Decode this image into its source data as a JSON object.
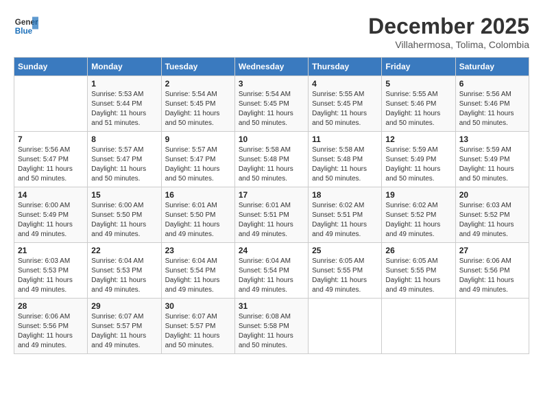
{
  "header": {
    "logo_line1": "General",
    "logo_line2": "Blue",
    "month": "December 2025",
    "location": "Villahermosa, Tolima, Colombia"
  },
  "weekdays": [
    "Sunday",
    "Monday",
    "Tuesday",
    "Wednesday",
    "Thursday",
    "Friday",
    "Saturday"
  ],
  "weeks": [
    [
      {
        "day": "",
        "sunrise": "",
        "sunset": "",
        "daylight": ""
      },
      {
        "day": "1",
        "sunrise": "Sunrise: 5:53 AM",
        "sunset": "Sunset: 5:44 PM",
        "daylight": "Daylight: 11 hours and 51 minutes."
      },
      {
        "day": "2",
        "sunrise": "Sunrise: 5:54 AM",
        "sunset": "Sunset: 5:45 PM",
        "daylight": "Daylight: 11 hours and 50 minutes."
      },
      {
        "day": "3",
        "sunrise": "Sunrise: 5:54 AM",
        "sunset": "Sunset: 5:45 PM",
        "daylight": "Daylight: 11 hours and 50 minutes."
      },
      {
        "day": "4",
        "sunrise": "Sunrise: 5:55 AM",
        "sunset": "Sunset: 5:45 PM",
        "daylight": "Daylight: 11 hours and 50 minutes."
      },
      {
        "day": "5",
        "sunrise": "Sunrise: 5:55 AM",
        "sunset": "Sunset: 5:46 PM",
        "daylight": "Daylight: 11 hours and 50 minutes."
      },
      {
        "day": "6",
        "sunrise": "Sunrise: 5:56 AM",
        "sunset": "Sunset: 5:46 PM",
        "daylight": "Daylight: 11 hours and 50 minutes."
      }
    ],
    [
      {
        "day": "7",
        "sunrise": "Sunrise: 5:56 AM",
        "sunset": "Sunset: 5:47 PM",
        "daylight": "Daylight: 11 hours and 50 minutes."
      },
      {
        "day": "8",
        "sunrise": "Sunrise: 5:57 AM",
        "sunset": "Sunset: 5:47 PM",
        "daylight": "Daylight: 11 hours and 50 minutes."
      },
      {
        "day": "9",
        "sunrise": "Sunrise: 5:57 AM",
        "sunset": "Sunset: 5:47 PM",
        "daylight": "Daylight: 11 hours and 50 minutes."
      },
      {
        "day": "10",
        "sunrise": "Sunrise: 5:58 AM",
        "sunset": "Sunset: 5:48 PM",
        "daylight": "Daylight: 11 hours and 50 minutes."
      },
      {
        "day": "11",
        "sunrise": "Sunrise: 5:58 AM",
        "sunset": "Sunset: 5:48 PM",
        "daylight": "Daylight: 11 hours and 50 minutes."
      },
      {
        "day": "12",
        "sunrise": "Sunrise: 5:59 AM",
        "sunset": "Sunset: 5:49 PM",
        "daylight": "Daylight: 11 hours and 50 minutes."
      },
      {
        "day": "13",
        "sunrise": "Sunrise: 5:59 AM",
        "sunset": "Sunset: 5:49 PM",
        "daylight": "Daylight: 11 hours and 50 minutes."
      }
    ],
    [
      {
        "day": "14",
        "sunrise": "Sunrise: 6:00 AM",
        "sunset": "Sunset: 5:49 PM",
        "daylight": "Daylight: 11 hours and 49 minutes."
      },
      {
        "day": "15",
        "sunrise": "Sunrise: 6:00 AM",
        "sunset": "Sunset: 5:50 PM",
        "daylight": "Daylight: 11 hours and 49 minutes."
      },
      {
        "day": "16",
        "sunrise": "Sunrise: 6:01 AM",
        "sunset": "Sunset: 5:50 PM",
        "daylight": "Daylight: 11 hours and 49 minutes."
      },
      {
        "day": "17",
        "sunrise": "Sunrise: 6:01 AM",
        "sunset": "Sunset: 5:51 PM",
        "daylight": "Daylight: 11 hours and 49 minutes."
      },
      {
        "day": "18",
        "sunrise": "Sunrise: 6:02 AM",
        "sunset": "Sunset: 5:51 PM",
        "daylight": "Daylight: 11 hours and 49 minutes."
      },
      {
        "day": "19",
        "sunrise": "Sunrise: 6:02 AM",
        "sunset": "Sunset: 5:52 PM",
        "daylight": "Daylight: 11 hours and 49 minutes."
      },
      {
        "day": "20",
        "sunrise": "Sunrise: 6:03 AM",
        "sunset": "Sunset: 5:52 PM",
        "daylight": "Daylight: 11 hours and 49 minutes."
      }
    ],
    [
      {
        "day": "21",
        "sunrise": "Sunrise: 6:03 AM",
        "sunset": "Sunset: 5:53 PM",
        "daylight": "Daylight: 11 hours and 49 minutes."
      },
      {
        "day": "22",
        "sunrise": "Sunrise: 6:04 AM",
        "sunset": "Sunset: 5:53 PM",
        "daylight": "Daylight: 11 hours and 49 minutes."
      },
      {
        "day": "23",
        "sunrise": "Sunrise: 6:04 AM",
        "sunset": "Sunset: 5:54 PM",
        "daylight": "Daylight: 11 hours and 49 minutes."
      },
      {
        "day": "24",
        "sunrise": "Sunrise: 6:04 AM",
        "sunset": "Sunset: 5:54 PM",
        "daylight": "Daylight: 11 hours and 49 minutes."
      },
      {
        "day": "25",
        "sunrise": "Sunrise: 6:05 AM",
        "sunset": "Sunset: 5:55 PM",
        "daylight": "Daylight: 11 hours and 49 minutes."
      },
      {
        "day": "26",
        "sunrise": "Sunrise: 6:05 AM",
        "sunset": "Sunset: 5:55 PM",
        "daylight": "Daylight: 11 hours and 49 minutes."
      },
      {
        "day": "27",
        "sunrise": "Sunrise: 6:06 AM",
        "sunset": "Sunset: 5:56 PM",
        "daylight": "Daylight: 11 hours and 49 minutes."
      }
    ],
    [
      {
        "day": "28",
        "sunrise": "Sunrise: 6:06 AM",
        "sunset": "Sunset: 5:56 PM",
        "daylight": "Daylight: 11 hours and 49 minutes."
      },
      {
        "day": "29",
        "sunrise": "Sunrise: 6:07 AM",
        "sunset": "Sunset: 5:57 PM",
        "daylight": "Daylight: 11 hours and 49 minutes."
      },
      {
        "day": "30",
        "sunrise": "Sunrise: 6:07 AM",
        "sunset": "Sunset: 5:57 PM",
        "daylight": "Daylight: 11 hours and 50 minutes."
      },
      {
        "day": "31",
        "sunrise": "Sunrise: 6:08 AM",
        "sunset": "Sunset: 5:58 PM",
        "daylight": "Daylight: 11 hours and 50 minutes."
      },
      {
        "day": "",
        "sunrise": "",
        "sunset": "",
        "daylight": ""
      },
      {
        "day": "",
        "sunrise": "",
        "sunset": "",
        "daylight": ""
      },
      {
        "day": "",
        "sunrise": "",
        "sunset": "",
        "daylight": ""
      }
    ]
  ]
}
